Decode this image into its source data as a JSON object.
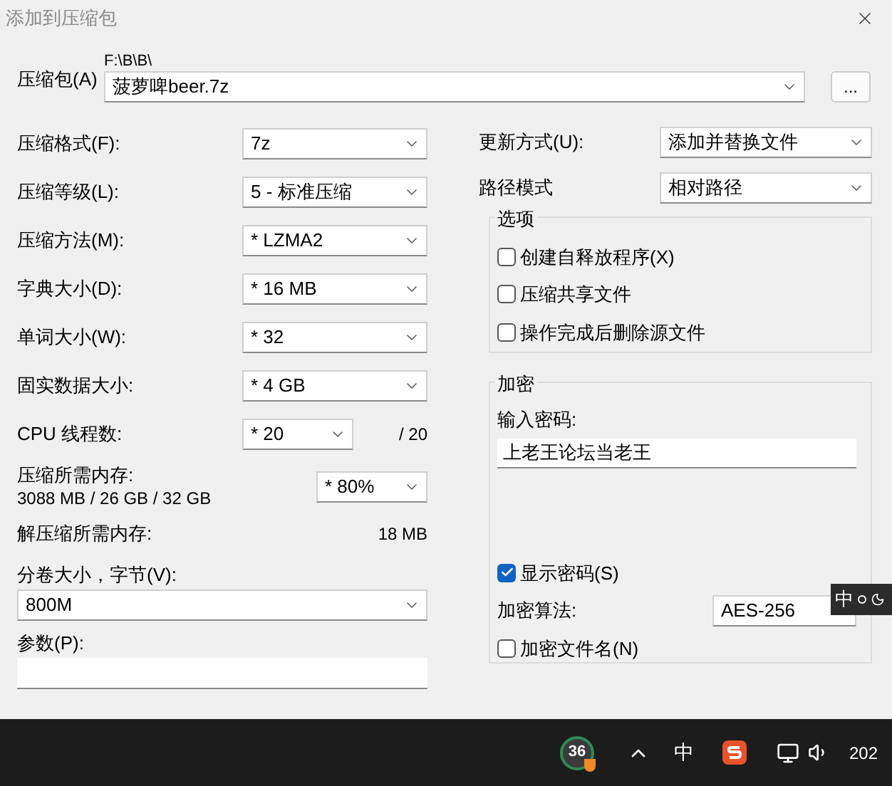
{
  "window": {
    "title": "添加到压缩包"
  },
  "archive": {
    "label": "压缩包(A)",
    "path": "F:\\B\\B\\",
    "value": "菠萝啤beer.7z",
    "browse": "..."
  },
  "left_fields": [
    {
      "label": "压缩格式(F):",
      "value": "7z"
    },
    {
      "label": "压缩等级(L):",
      "value": "5 - 标准压缩"
    },
    {
      "label": "压缩方法(M):",
      "value": "*  LZMA2"
    },
    {
      "label": "字典大小(D):",
      "value": "*  16 MB"
    },
    {
      "label": "单词大小(W):",
      "value": "*  32"
    },
    {
      "label": "固实数据大小:",
      "value": "*  4 GB"
    }
  ],
  "cpu": {
    "label": "CPU 线程数:",
    "value": "*  20",
    "total": "/ 20"
  },
  "memory": {
    "label": "压缩所需内存:",
    "detail": "3088 MB / 26 GB / 32 GB",
    "value": "* 80%"
  },
  "decompress_memory": {
    "label": "解压缩所需内存:",
    "value": "18 MB"
  },
  "volume": {
    "label": "分卷大小，字节(V):",
    "value": "800M"
  },
  "params": {
    "label": "参数(P):"
  },
  "right_fields": [
    {
      "label": "更新方式(U):",
      "value": "添加并替换文件"
    },
    {
      "label": "路径模式",
      "value": "相对路径"
    }
  ],
  "options": {
    "title": "选项",
    "items": [
      {
        "label": "创建自释放程序(X)",
        "checked": false
      },
      {
        "label": "压缩共享文件",
        "checked": false
      },
      {
        "label": "操作完成后删除源文件",
        "checked": false
      }
    ]
  },
  "encryption": {
    "title": "加密",
    "password_label": "输入密码:",
    "password": "上老王论坛当老王",
    "show_password": {
      "label": "显示密码(S)",
      "checked": true
    },
    "method_label": "加密算法:",
    "method": "AES-256",
    "encrypt_names": {
      "label": "加密文件名(N)",
      "checked": false
    }
  },
  "ime_bar": {
    "mode": "中"
  },
  "taskbar": {
    "badge": "36",
    "ime": "中",
    "clock": "202"
  }
}
